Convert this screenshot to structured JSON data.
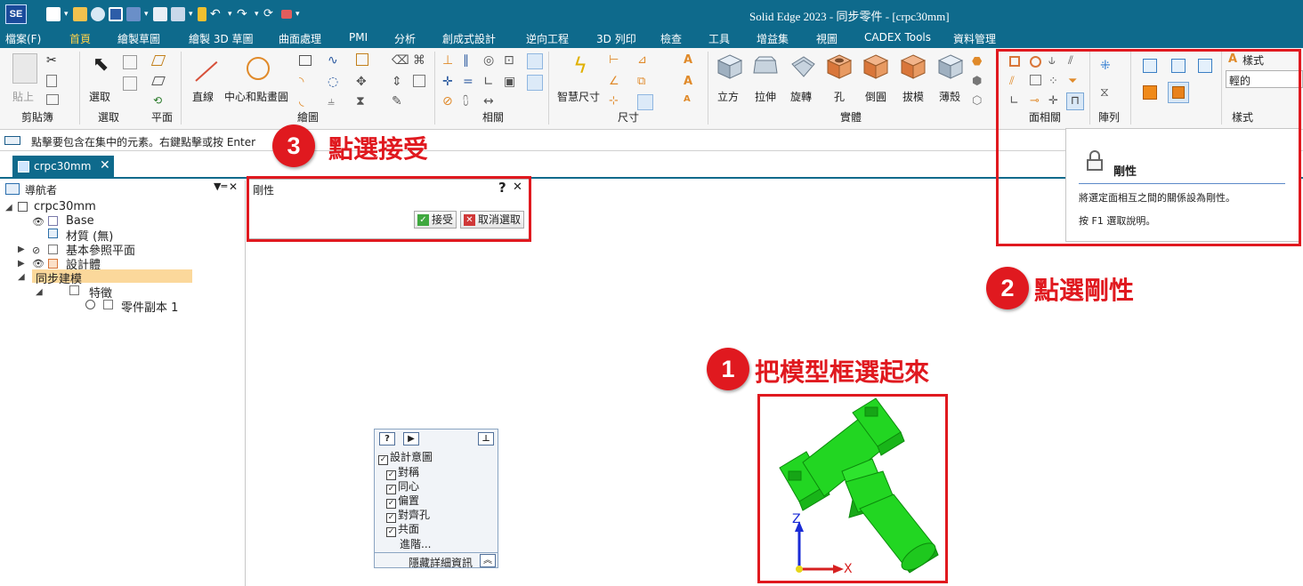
{
  "app": {
    "logo_text": "SE",
    "window_title": "Solid Edge 2023 - 同步零件 - [crpc30mm]"
  },
  "menu": {
    "file": "檔案(F)",
    "tabs": [
      "首頁",
      "繪製草圖",
      "繪製 3D 草圖",
      "曲面處理",
      "PMI",
      "分析",
      "創成式設計",
      "逆向工程",
      "3D 列印",
      "檢查",
      "工具",
      "增益集",
      "視圖",
      "CADEX Tools",
      "資料管理"
    ]
  },
  "ribbon": {
    "paste": "貼上",
    "clipboard": "剪貼簿",
    "select_btn": "選取",
    "select_group": "選取",
    "plane": "平面",
    "line": "直線",
    "center_circle": "中心和點畫圓",
    "draw": "繪圖",
    "relate": "相關",
    "smart_dim": "智慧尺寸",
    "dimension": "尺寸",
    "solids": [
      "立方",
      "拉伸",
      "旋轉",
      "孔",
      "倒圓",
      "拔模",
      "薄殼"
    ],
    "solid_group": "實體",
    "face_relate": "面相關",
    "pattern": "陣列",
    "style_label": "樣式",
    "style_value": "輕的",
    "style_group": "樣式"
  },
  "prompt": {
    "text": "點擊要包含在集中的元素。右鍵點擊或按 Enter"
  },
  "doc_tab": {
    "label": "crpc30mm"
  },
  "navigator": {
    "title": "導航者",
    "root": "crpc30mm",
    "items": {
      "base": "Base",
      "material": "材質 (無)",
      "ref_planes": "基本參照平面",
      "design_body": "設計體",
      "sync_model": "同步建模",
      "features": "特徵",
      "part_copy": "零件副本 1"
    }
  },
  "rigid_dialog": {
    "title": "剛性",
    "help": "?",
    "accept": "接受",
    "cancel_select": "取消選取"
  },
  "tooltip": {
    "title": "剛性",
    "description": "將選定面相互之間的關係設為剛性。",
    "f1_hint": "按 F1 選取說明。"
  },
  "intent_panel": {
    "header": "設計意圖",
    "options": [
      "對稱",
      "同心",
      "偏置",
      "對齊孔",
      "共面"
    ],
    "advanced": "進階...",
    "hide_details": "隱藏詳細資訊"
  },
  "annotations": {
    "step1_num": "1",
    "step1_text": "把模型框選起來",
    "step2_num": "2",
    "step2_text": "點選剛性",
    "step3_num": "3",
    "step3_text": "點選接受"
  },
  "axes": {
    "z": "Z",
    "x": "X"
  },
  "colors": {
    "titlebar": "#0e6a8c",
    "annotation_red": "#e0191f",
    "model_green": "#22d622"
  }
}
